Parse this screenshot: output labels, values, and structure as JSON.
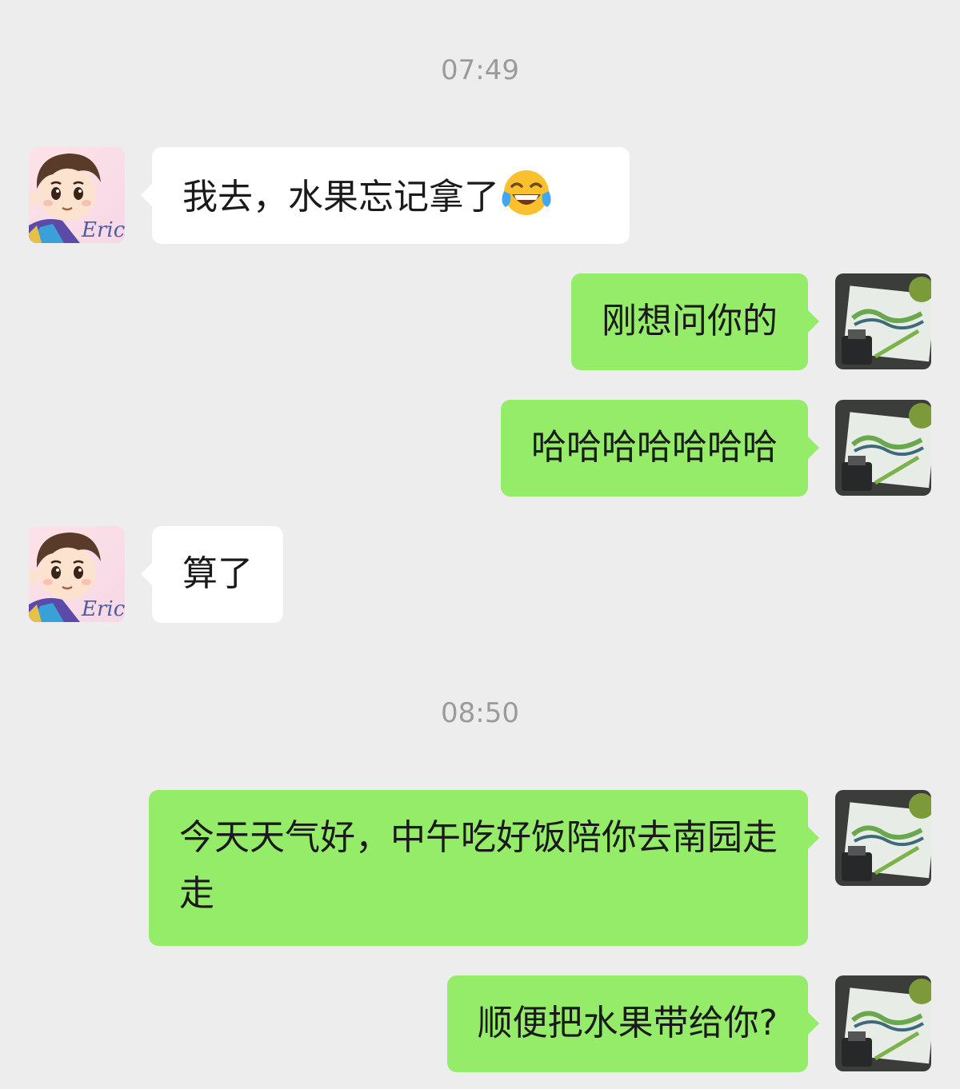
{
  "chat": {
    "timestamps": [
      "07:49",
      "08:50"
    ],
    "contact_avatar_text": "Eric",
    "messages": [
      {
        "side": "left",
        "text": "我去，水果忘记拿了",
        "emoji": "face-with-tears-of-joy"
      },
      {
        "side": "right",
        "text": "刚想问你的"
      },
      {
        "side": "right",
        "text": "哈哈哈哈哈哈哈"
      },
      {
        "side": "left",
        "text": "算了"
      },
      {
        "side": "right",
        "text": "今天天气好，中午吃好饭陪你去南园走走"
      },
      {
        "side": "right",
        "text": "顺便把水果带给你?"
      }
    ]
  },
  "colors": {
    "background": "#ededed",
    "bubble_self": "#95ec69",
    "bubble_other": "#ffffff",
    "timestamp": "#9b9b9b"
  }
}
